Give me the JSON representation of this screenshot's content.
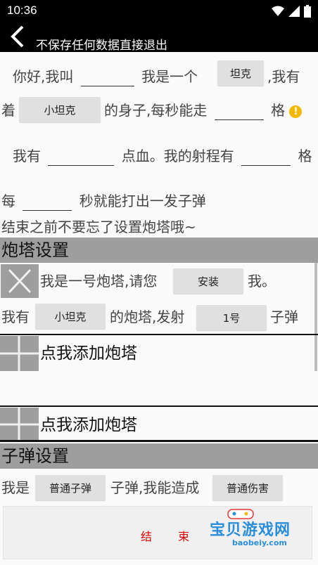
{
  "status": {
    "time": "10:36"
  },
  "appbar": {
    "title": "不保存任何数据直接退出"
  },
  "intro": {
    "l1_a": "你好,我叫",
    "l1_b": "我是一个",
    "type_btn": "坦克",
    "l1_c": ",我有",
    "l2_a": "着",
    "body_btn": "小坦克",
    "l2_b": "的身子,每秒能走",
    "l2_c": "格",
    "l3_a": "我有",
    "l3_b": "点血。我的射程有",
    "l3_c": "格",
    "l4_a": "每",
    "l4_b": "秒就能打出一发子弹",
    "l5": "结束之前不要忘了设置炮塔哦~"
  },
  "turret_section": {
    "title": "炮塔设置"
  },
  "turret1": {
    "a": "我是一号炮塔,请您",
    "install_btn": "安装",
    "b": "我。",
    "c": "我有",
    "turret_btn": "小坦克",
    "d": "的炮塔,发射",
    "ammo_btn": "1号",
    "e": "子弹"
  },
  "add_turret": {
    "label": "点我添加炮塔"
  },
  "bullet_section": {
    "title": "子弹设置"
  },
  "bullet": {
    "a": "我是",
    "kind_btn": "普通子弹",
    "b": "子弹,我能造成",
    "damage_btn": "普通伤害"
  },
  "footer": {
    "end_label": "结 束"
  },
  "watermark": {
    "text": "宝贝游戏网",
    "url": "baobeiy.com"
  },
  "colors": {
    "accent_warning": "#f5b800",
    "end_text": "#d60000",
    "section_bg": "#9e9e9e"
  }
}
